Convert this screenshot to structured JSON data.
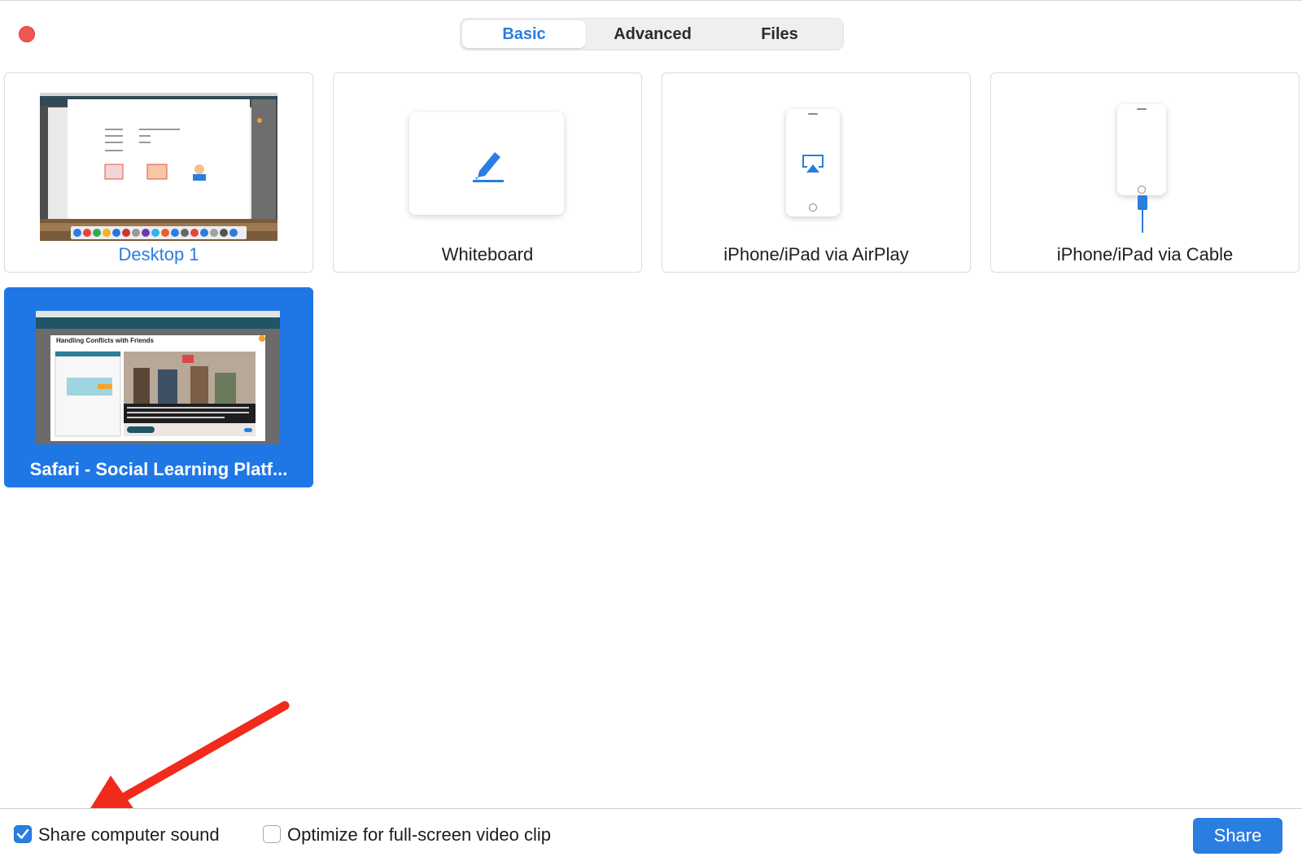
{
  "tabs": [
    {
      "label": "Basic",
      "active": true
    },
    {
      "label": "Advanced",
      "active": false
    },
    {
      "label": "Files",
      "active": false
    }
  ],
  "tiles": [
    {
      "label": "Desktop 1",
      "icon": "desktop-thumbnail"
    },
    {
      "label": "Whiteboard",
      "icon": "pencil-icon"
    },
    {
      "label": "iPhone/iPad via AirPlay",
      "icon": "airplay-icon"
    },
    {
      "label": "iPhone/iPad via Cable",
      "icon": "cable-icon"
    },
    {
      "label": "Safari - Social Learning Platf...",
      "icon": "window-thumbnail",
      "selected": true
    }
  ],
  "safari_thumb": {
    "heading": "Handling Conflicts with Friends"
  },
  "options": {
    "share_sound": {
      "label": "Share computer sound",
      "checked": true
    },
    "optimize_video": {
      "label": "Optimize for full-screen video clip",
      "checked": false
    }
  },
  "share_button": {
    "label": "Share"
  },
  "colors": {
    "accent": "#2a7de1",
    "selected_tile": "#1f77e6",
    "close": "#f25650",
    "arrow": "#f02a1c"
  }
}
